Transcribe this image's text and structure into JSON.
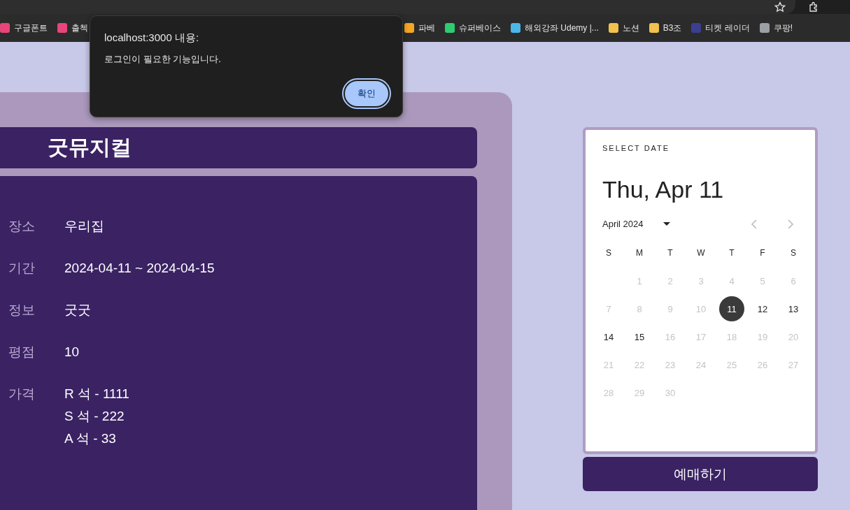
{
  "bookmarks_left": [
    {
      "label": "구글폰트"
    },
    {
      "label": "출첵"
    }
  ],
  "bookmarks_right": [
    {
      "label": "파베"
    },
    {
      "label": "슈퍼베이스"
    },
    {
      "label": "해외강좌 Udemy |..."
    },
    {
      "label": "노션"
    },
    {
      "label": "B3조"
    },
    {
      "label": "티켓 레이더"
    },
    {
      "label": "쿠팡!"
    }
  ],
  "show": {
    "title": "굿뮤지컬",
    "details": [
      {
        "label": "장소",
        "lines": [
          "우리집"
        ]
      },
      {
        "label": "기간",
        "lines": [
          "2024-04-11 ~ 2024-04-15"
        ]
      },
      {
        "label": "정보",
        "lines": [
          "굿굿"
        ]
      },
      {
        "label": "평점",
        "lines": [
          "10"
        ]
      },
      {
        "label": "가격",
        "lines": [
          "R 석 - 1111",
          "S 석 - 222",
          "A 석 - 33"
        ]
      }
    ]
  },
  "date_picker": {
    "heading": "SELECT DATE",
    "selected_date": "Thu, Apr 11",
    "month": "April 2024",
    "weekdays": [
      "S",
      "M",
      "T",
      "W",
      "T",
      "F",
      "S"
    ],
    "days": [
      {
        "label": "1",
        "disabled": true,
        "selected": false
      },
      {
        "label": "2",
        "disabled": true,
        "selected": false
      },
      {
        "label": "3",
        "disabled": true,
        "selected": false
      },
      {
        "label": "4",
        "disabled": true,
        "selected": false
      },
      {
        "label": "5",
        "disabled": true,
        "selected": false
      },
      {
        "label": "6",
        "disabled": true,
        "selected": false
      },
      {
        "label": "7",
        "disabled": true,
        "selected": false
      },
      {
        "label": "8",
        "disabled": true,
        "selected": false
      },
      {
        "label": "9",
        "disabled": true,
        "selected": false
      },
      {
        "label": "10",
        "disabled": true,
        "selected": false
      },
      {
        "label": "11",
        "disabled": false,
        "selected": true
      },
      {
        "label": "12",
        "disabled": false,
        "selected": false
      },
      {
        "label": "13",
        "disabled": false,
        "selected": false
      },
      {
        "label": "14",
        "disabled": false,
        "selected": false
      },
      {
        "label": "15",
        "disabled": false,
        "selected": false
      },
      {
        "label": "16",
        "disabled": true,
        "selected": false
      },
      {
        "label": "17",
        "disabled": true,
        "selected": false
      },
      {
        "label": "18",
        "disabled": true,
        "selected": false
      },
      {
        "label": "19",
        "disabled": true,
        "selected": false
      },
      {
        "label": "20",
        "disabled": true,
        "selected": false
      },
      {
        "label": "21",
        "disabled": true,
        "selected": false
      },
      {
        "label": "22",
        "disabled": true,
        "selected": false
      },
      {
        "label": "23",
        "disabled": true,
        "selected": false
      },
      {
        "label": "24",
        "disabled": true,
        "selected": false
      },
      {
        "label": "25",
        "disabled": true,
        "selected": false
      },
      {
        "label": "26",
        "disabled": true,
        "selected": false
      },
      {
        "label": "27",
        "disabled": true,
        "selected": false
      },
      {
        "label": "28",
        "disabled": true,
        "selected": false
      },
      {
        "label": "29",
        "disabled": true,
        "selected": false
      },
      {
        "label": "30",
        "disabled": true,
        "selected": false
      }
    ]
  },
  "book_button": "예매하기",
  "alert": {
    "title": "localhost:3000 내용:",
    "message": "로그인이 필요한 기능입니다.",
    "ok_button": "확인"
  }
}
